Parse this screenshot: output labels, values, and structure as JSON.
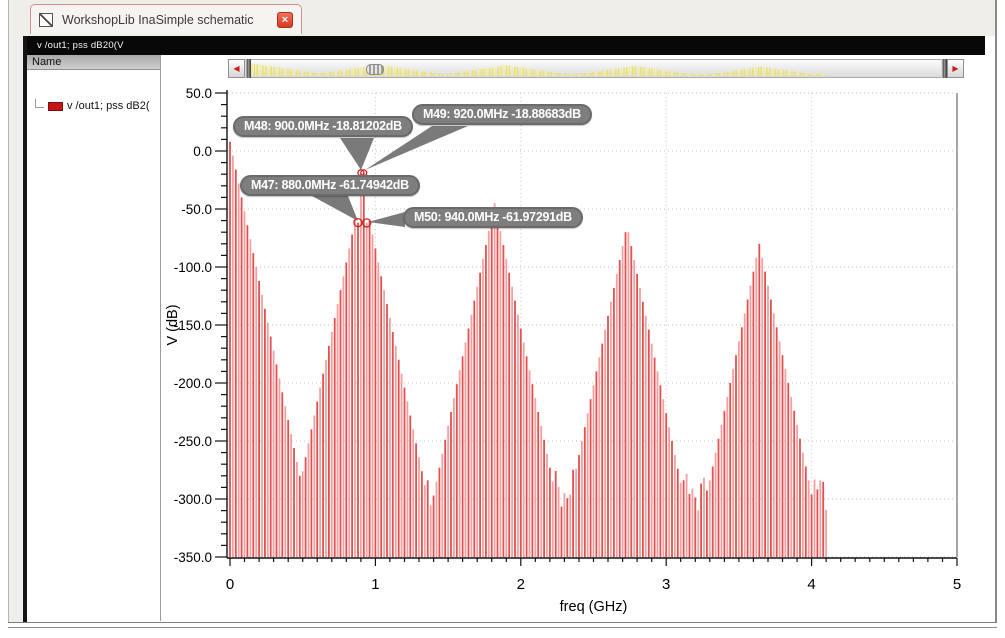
{
  "tab": {
    "title": "WorkshopLib InaSimple schematic",
    "close_glyph": "×"
  },
  "title_bar": {
    "text": "v /out1; pss dB20(V"
  },
  "sidebar": {
    "header": "Name",
    "legend": {
      "label": "v /out1; pss dB2(",
      "swatch_color": "#c41414"
    }
  },
  "scrollbar": {
    "left_arrow": "◀",
    "right_arrow": "▶"
  },
  "chart_data": {
    "type": "bar",
    "title": "",
    "xlabel": "freq (GHz)",
    "ylabel": "V (dB)",
    "xlim": [
      0,
      5
    ],
    "ylim": [
      -350,
      50
    ],
    "x_ticks": [
      0,
      1,
      2,
      3,
      4,
      5
    ],
    "y_ticks": [
      50,
      0,
      -50,
      -100,
      -150,
      -200,
      -250,
      -300,
      -350
    ],
    "y_tick_labels": [
      "50.0",
      "0.0",
      "-50.0",
      "-100.0",
      "-150.0",
      "-200.0",
      "-250.0",
      "-300.0",
      "-350.0"
    ],
    "grid": "dotted",
    "legend_position": "left-panel",
    "series_name": "v /out1; pss dB20(V)",
    "bar_step_GHz": 0.02,
    "data_max_GHz": 4.1,
    "harmonic_peaks": [
      {
        "center_GHz": 0.0,
        "top_dB": 8
      },
      {
        "center_GHz": 0.91,
        "top_dB": -30
      },
      {
        "center_GHz": 1.82,
        "top_dB": -45
      },
      {
        "center_GHz": 2.73,
        "top_dB": -64
      },
      {
        "center_GHz": 3.64,
        "top_dB": -80
      }
    ],
    "envelope_slope_dB_per_GHz": 600,
    "noise_floor_dB": -293,
    "point_overrides_by_index": {
      "44": -61.74942,
      "45": -18.81202,
      "46": -18.88683,
      "47": -61.97291
    },
    "markers": [
      {
        "id": "M47",
        "label": "M47: 880.0MHz -61.74942dB",
        "freq_GHz": 0.88,
        "value_dB": -61.74942
      },
      {
        "id": "M48",
        "label": "M48: 900.0MHz -18.81202dB",
        "freq_GHz": 0.9,
        "value_dB": -18.81202
      },
      {
        "id": "M49",
        "label": "M49: 920.0MHz -18.88683dB",
        "freq_GHz": 0.92,
        "value_dB": -18.88683
      },
      {
        "id": "M50",
        "label": "M50: 940.0MHz -61.97291dB",
        "freq_GHz": 0.94,
        "value_dB": -61.97291
      }
    ],
    "bar_color_dark": "#e25050",
    "bar_color_light": "#f5a0a0",
    "marker_circle_color": "#cc2222",
    "mini_bar_color": "#ece25c"
  }
}
